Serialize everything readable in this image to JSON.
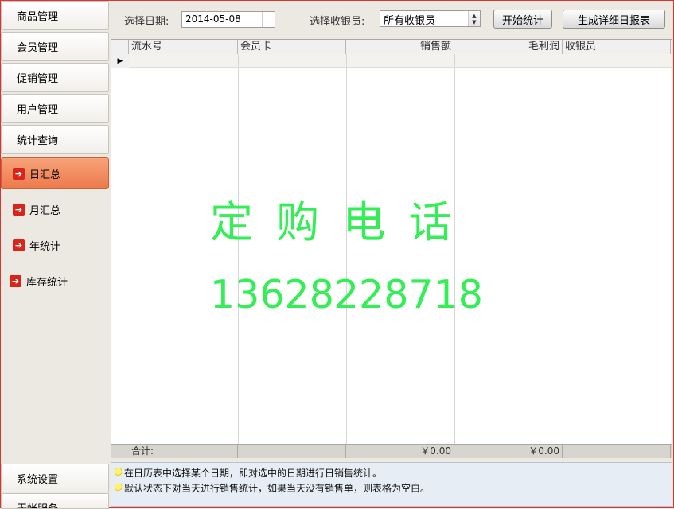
{
  "sidebar": {
    "top_items": [
      "商品管理",
      "会员管理",
      "促销管理",
      "用户管理",
      "统计查询"
    ],
    "sub_items": [
      "日汇总",
      "月汇总",
      "年统计",
      "库存统计"
    ],
    "active_sub_item": "日汇总",
    "bottom_items": [
      "系统设置",
      "无帐服务"
    ]
  },
  "toolbar": {
    "date_label": "选择日期:",
    "date_value": "2014-05-08",
    "cashier_label": "选择收银员:",
    "cashier_selected": "所有收银员",
    "stats_button": "开始统计",
    "report_button": "生成详细日报表"
  },
  "grid": {
    "columns": [
      "流水号",
      "会员卡",
      "销售额",
      "毛利润",
      "收银员"
    ],
    "footer": {
      "total_label": "合计:",
      "sales_total": "￥0.00",
      "profit_total": "￥0.00"
    }
  },
  "overlay": {
    "line1": "定 购 电 话",
    "line2": "13628228718"
  },
  "tips": [
    "在日历表中选择某个日期，即对选中的日期进行日销售统计。",
    "默认状态下对当天进行销售统计，如果当天没有销售单，则表格为空白。"
  ],
  "colors": {
    "active_item": "#EC7A4B",
    "overlay_text": "#33EE55",
    "arrow_icon": "#D9241B"
  }
}
